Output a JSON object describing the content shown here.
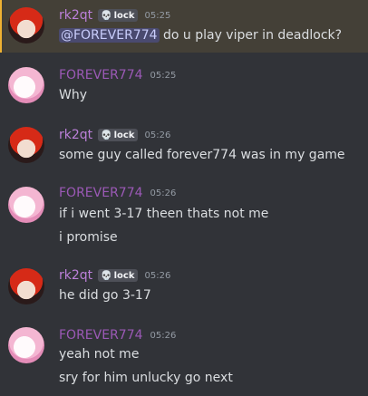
{
  "messages": [
    {
      "author": "rk2qt",
      "tag": "lock",
      "tag_icon": "skull-icon",
      "time": "05:25",
      "mention": "@FOREVER774",
      "text": " do u play viper in deadlock?"
    },
    {
      "author": "FOREVER774",
      "time": "05:25",
      "lines": [
        "Why"
      ]
    },
    {
      "author": "rk2qt",
      "tag": "lock",
      "tag_icon": "skull-icon",
      "time": "05:26",
      "lines": [
        "some guy called forever774 was in my game"
      ]
    },
    {
      "author": "FOREVER774",
      "time": "05:26",
      "lines": [
        "if i went 3-17 theen thats not me",
        "i promise"
      ]
    },
    {
      "author": "rk2qt",
      "tag": "lock",
      "tag_icon": "skull-icon",
      "time": "05:26",
      "lines": [
        "he did go 3-17"
      ]
    },
    {
      "author": "FOREVER774",
      "time": "05:26",
      "lines": [
        "yeah not me",
        "sry for him unlucky go next"
      ]
    }
  ],
  "colors": {
    "background": "#313338",
    "highlight": "#444037",
    "accent": "#f0b232",
    "rk_name": "#bc80d9",
    "fv_name": "#9b59b6"
  }
}
